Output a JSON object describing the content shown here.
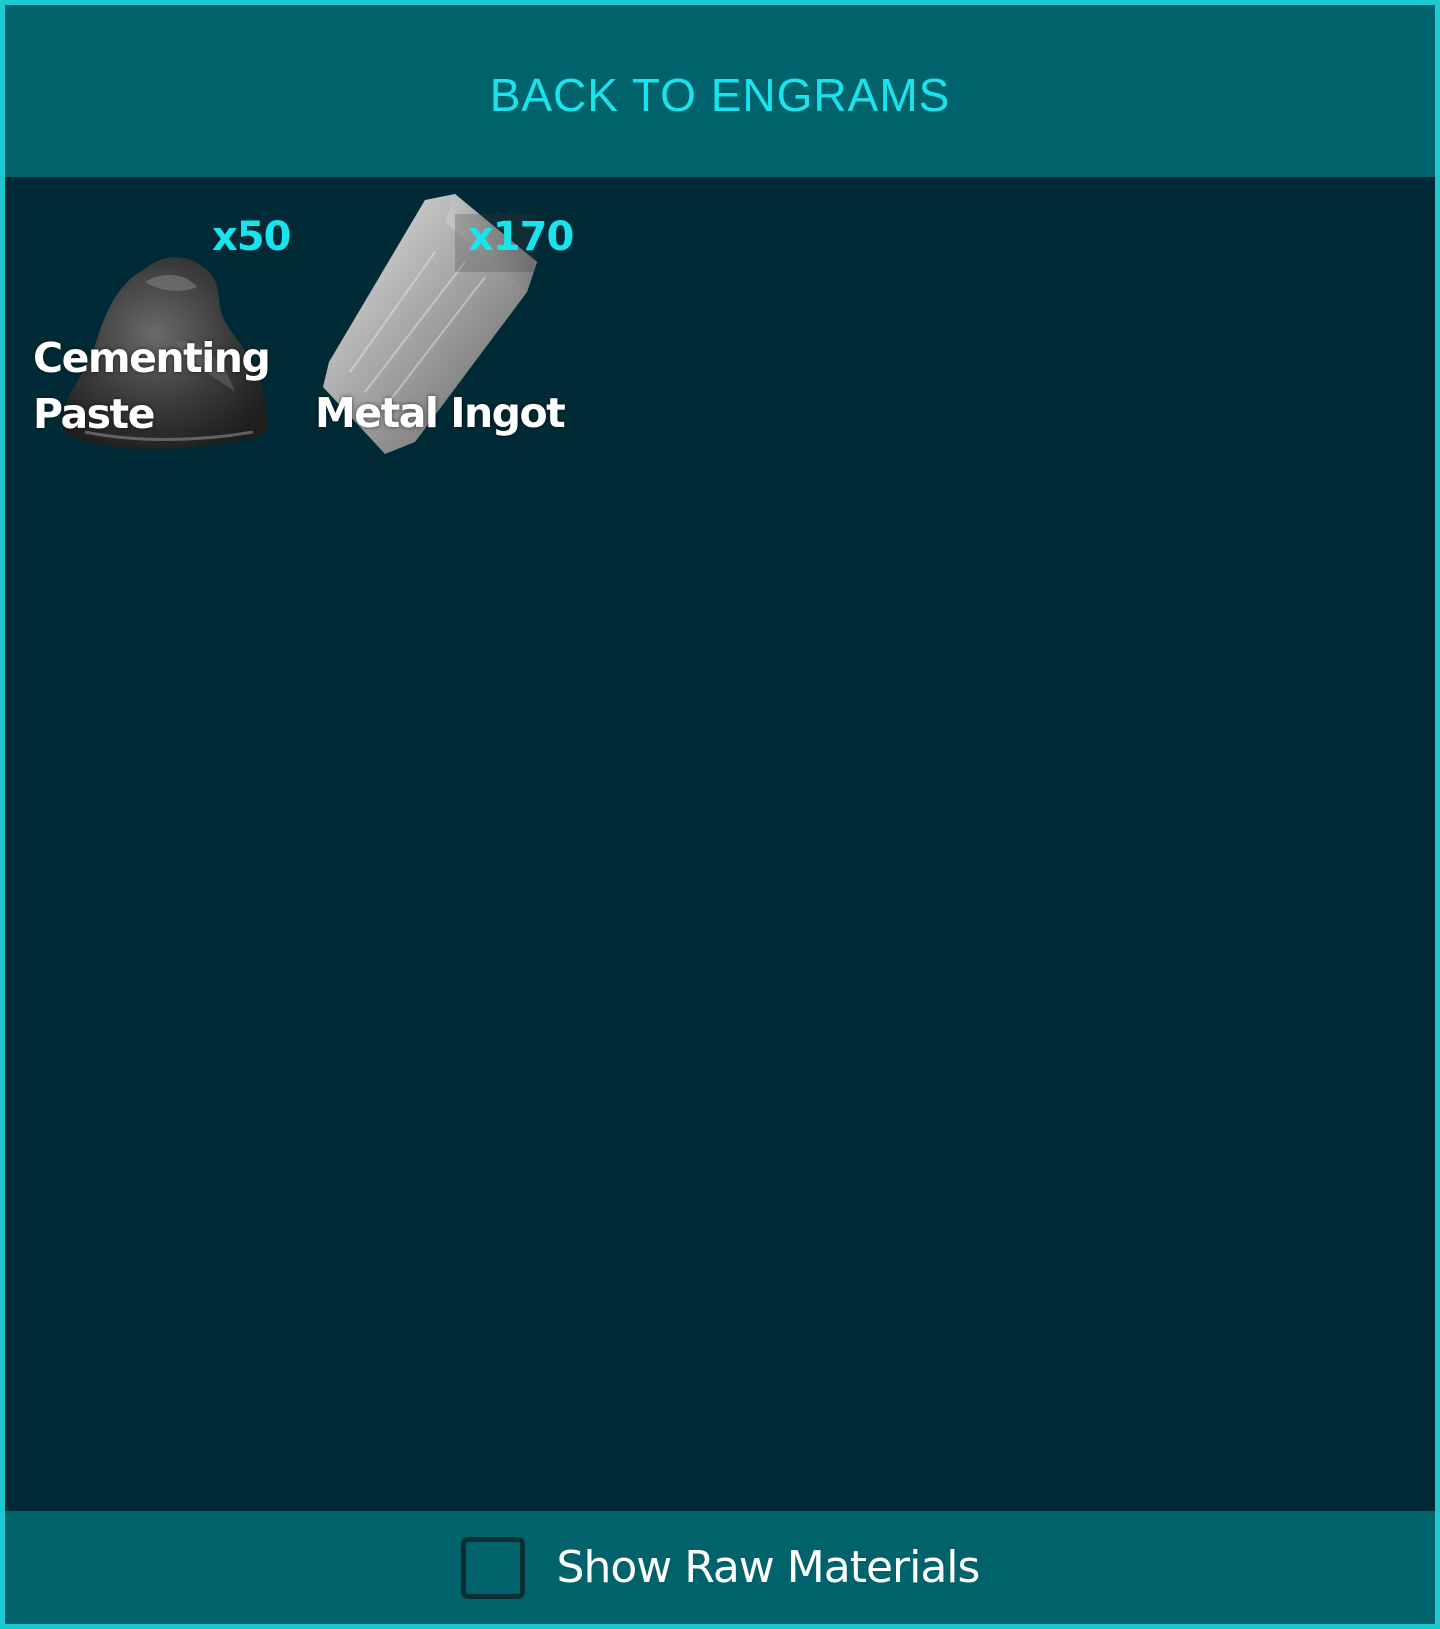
{
  "header": {
    "back_label": "BACK TO ENGRAMS"
  },
  "items": [
    {
      "name_line1": "Cementing",
      "name_line2": "Paste",
      "quantity": "x50",
      "icon": "cementing-paste-icon"
    },
    {
      "name_line1": "Metal Ingot",
      "name_line2": "",
      "quantity": "x170",
      "icon": "metal-ingot-icon"
    }
  ],
  "footer": {
    "checkbox_label": "Show Raw Materials",
    "checked": false
  },
  "colors": {
    "accent": "#19e3ec",
    "panel": "#00636b",
    "background": "#002b36",
    "border": "#1ec8d0"
  }
}
